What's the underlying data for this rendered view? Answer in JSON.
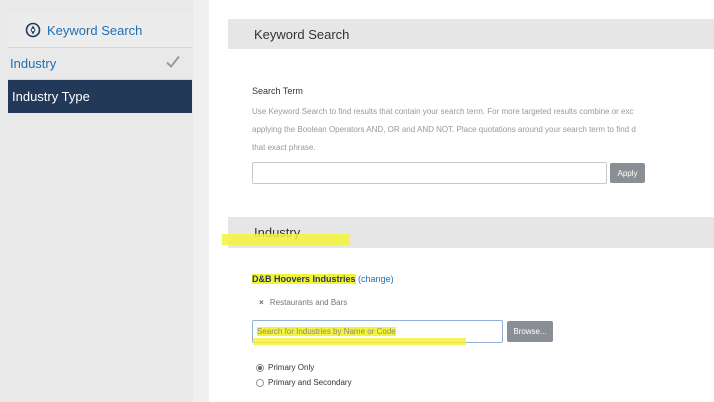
{
  "sidebar": {
    "keyword_search": "Keyword Search",
    "industry": "Industry",
    "industry_type": "Industry Type"
  },
  "keyword_section": {
    "header": "Keyword Search",
    "search_term_label": "Search Term",
    "description_lines": [
      "Use Keyword Search to find results that contain your search term. For more targeted results combine or exc",
      "applying the Boolean Operators AND, OR and AND NOT. Place quotations around your search term to find d",
      "that exact phrase."
    ],
    "search_value": "",
    "apply_label": "Apply"
  },
  "industry_section": {
    "header": "Industry",
    "dnb_label": "D&B Hoovers Industries",
    "change_label": "(change)",
    "selected_chip": "Restaurants and Bars",
    "input_placeholder": "Search for Industries by Name or Code",
    "browse_label": "Browse...",
    "radio_primary_only": "Primary Only",
    "radio_primary_secondary": "Primary and Secondary",
    "selected_radio": "Primary Only"
  },
  "colors": {
    "accent": "#1f6fb5",
    "sidebar_active": "#23395a",
    "highlight": "#f3f33a"
  }
}
